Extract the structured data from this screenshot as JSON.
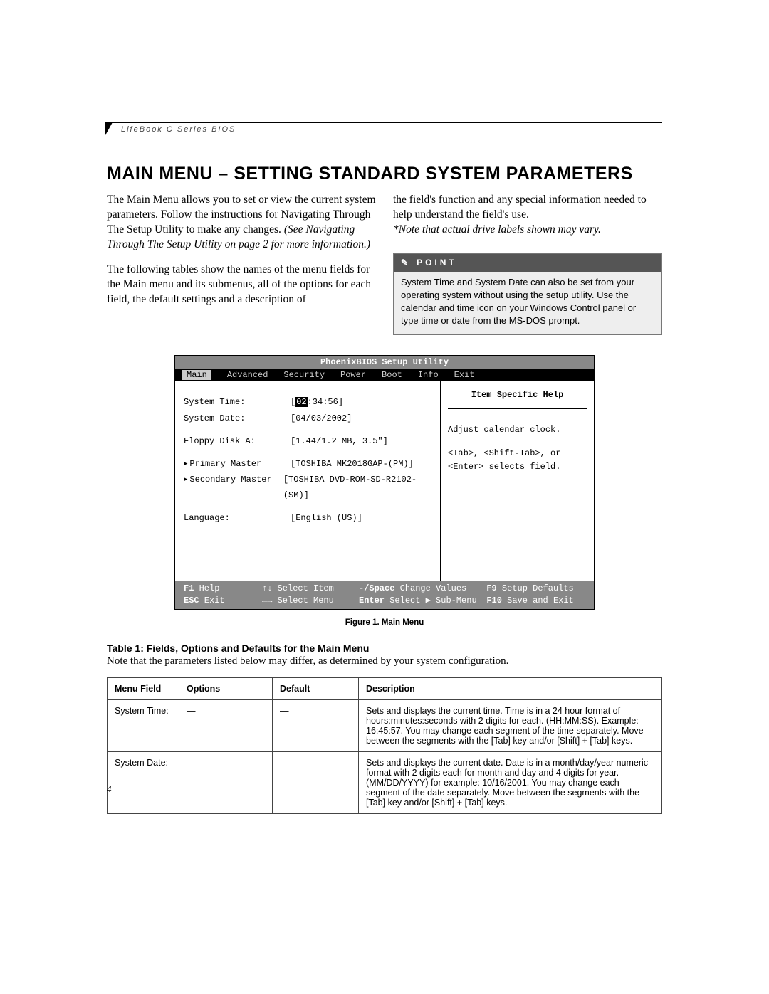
{
  "header": "LifeBook C Series BIOS",
  "title": "MAIN MENU – SETTING STANDARD SYSTEM PARAMETERS",
  "col1_p1": "The Main Menu allows you to set or view the current system parameters. Follow the instructions for Navigating Through The Setup Utility to make any changes.",
  "col1_p1_em": "(See Navigating Through The Setup Utility on page 2 for more information.)",
  "col1_p2": "The following tables show the names of the menu fields for the Main menu and its submenus, all of the options for each field, the default settings and a description of",
  "col2_p1": "the field's function and any special information needed to help understand the field's use.",
  "col2_p1_em": "*Note that actual drive labels shown may vary.",
  "point_label": "POINT",
  "point_body": "System Time and System Date can also be set from your operating system without using the setup utility. Use the calendar and time icon on your Windows Control panel or type time or date from the MS-DOS prompt.",
  "bios": {
    "title": "PhoenixBIOS Setup Utility",
    "menu": [
      "Main",
      "Advanced",
      "Security",
      "Power",
      "Boot",
      "Info",
      "Exit"
    ],
    "rows": [
      {
        "label": "System Time:",
        "value_pre": "[",
        "cursor": "02",
        "value_post": ":34:56]"
      },
      {
        "label": "System Date:",
        "value": "[04/03/2002]"
      },
      {
        "label": "Floppy Disk A:",
        "value": "[1.44/1.2 MB, 3.5\"]",
        "gap": true
      },
      {
        "label": "Primary Master",
        "value": "[TOSHIBA MK2018GAP-(PM)]",
        "arrow": true,
        "gap": true
      },
      {
        "label": "Secondary Master",
        "value": "[TOSHIBA DVD-ROM-SD-R2102-(SM)]",
        "arrow": true
      },
      {
        "label": "Language:",
        "value": "[English (US)]",
        "gap": true
      }
    ],
    "help_title": "Item Specific Help",
    "help_text1": "Adjust calendar clock.",
    "help_text2": "<Tab>, <Shift-Tab>, or <Enter> selects field.",
    "footer": [
      {
        "k": "F1",
        "t": "Help"
      },
      {
        "k": "↑↓",
        "t": "Select Item"
      },
      {
        "k": "-/Space",
        "t": "Change Values"
      },
      {
        "k": "F9",
        "t": "Setup Defaults"
      },
      {
        "k": "ESC",
        "t": "Exit"
      },
      {
        "k": "←→",
        "t": "Select Menu"
      },
      {
        "k": "Enter",
        "t": "Select ▶ Sub-Menu"
      },
      {
        "k": "F10",
        "t": "Save and Exit"
      }
    ]
  },
  "figure_caption": "Figure 1.   Main Menu",
  "table_title": "Table 1: Fields, Options and Defaults for the Main Menu",
  "table_note": "Note that the parameters listed below may differ, as determined by your system configuration.",
  "table_headers": [
    "Menu Field",
    "Options",
    "Default",
    "Description"
  ],
  "table_rows": [
    {
      "field": "System Time:",
      "options": "—",
      "default": "—",
      "desc": "Sets and displays the current time. Time is in a 24 hour format of hours:minutes:seconds with 2 digits for each. (HH:MM:SS). Example: 16:45:57. You may change each segment of the time separately. Move between the segments with the [Tab] key and/or [Shift] + [Tab] keys."
    },
    {
      "field": "System Date:",
      "options": "—",
      "default": "—",
      "desc": "Sets and displays the current date. Date is in a month/day/year numeric format with 2 digits each for month and day and 4 digits for year. (MM/DD/YYYY) for example: 10/16/2001. You may change each segment of the date separately. Move between the segments with the [Tab] key and/or [Shift] + [Tab] keys."
    }
  ],
  "page_number": "4"
}
